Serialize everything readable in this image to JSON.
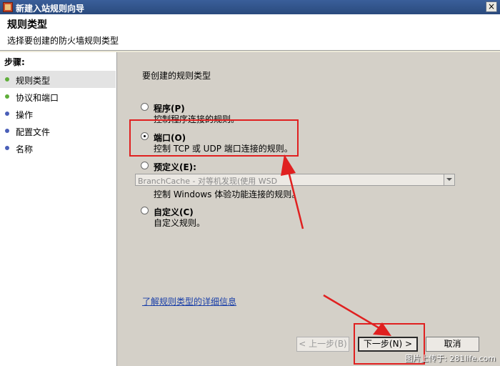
{
  "window": {
    "title": "新建入站规则向导",
    "close_glyph": "×"
  },
  "header": {
    "title": "规则类型",
    "subtitle": "选择要创建的防火墙规则类型"
  },
  "sidebar": {
    "title": "步骤:",
    "steps": [
      {
        "label": "规则类型",
        "color": "#5fae3a"
      },
      {
        "label": "协议和端口",
        "color": "#5fae3a"
      },
      {
        "label": "操作",
        "color": "#4a5fb8"
      },
      {
        "label": "配置文件",
        "color": "#4a5fb8"
      },
      {
        "label": "名称",
        "color": "#4a5fb8"
      }
    ]
  },
  "main": {
    "instruction": "要创建的规则类型",
    "options": [
      {
        "label": "程序(P)",
        "description": "控制程序连接的规则。",
        "checked": false
      },
      {
        "label": "端口(O)",
        "description": "控制 TCP 或 UDP 端口连接的规则。",
        "checked": true
      },
      {
        "label": "预定义(E):",
        "description": "控制 Windows 体验功能连接的规则。",
        "checked": false
      },
      {
        "label": "自定义(C)",
        "description": "自定义规则。",
        "checked": false
      }
    ],
    "predefined_select": "BranchCache - 对等机发现(使用 WSD",
    "info_link": "了解规则类型的详细信息"
  },
  "buttons": {
    "back": "< 上一步(B)",
    "next": "下一步(N) >",
    "cancel": "取消"
  },
  "watermark": "图片上传于: 281life.com",
  "colors": {
    "callout": "#e02020",
    "link": "#1a3fa8"
  }
}
